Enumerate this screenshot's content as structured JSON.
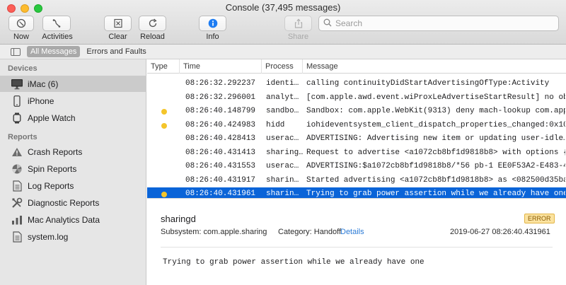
{
  "window": {
    "title": "Console (37,495 messages)"
  },
  "toolbar": {
    "now_label": "Now",
    "activities_label": "Activities",
    "clear_label": "Clear",
    "reload_label": "Reload",
    "info_label": "Info",
    "share_label": "Share",
    "search_placeholder": "Search"
  },
  "scope": {
    "all_messages": "All Messages",
    "errors_and_faults": "Errors and Faults"
  },
  "sidebar": {
    "devices_title": "Devices",
    "devices": [
      {
        "label": "iMac (6)",
        "icon": "imac-icon",
        "selected": true
      },
      {
        "label": "iPhone",
        "icon": "iphone-icon",
        "selected": false
      },
      {
        "label": "Apple Watch",
        "icon": "apple-watch-icon",
        "selected": false
      }
    ],
    "reports_title": "Reports",
    "reports": [
      {
        "label": "Crash Reports",
        "icon": "warning-icon"
      },
      {
        "label": "Spin Reports",
        "icon": "spin-icon"
      },
      {
        "label": "Log Reports",
        "icon": "document-icon"
      },
      {
        "label": "Diagnostic Reports",
        "icon": "tools-icon"
      },
      {
        "label": "Mac Analytics Data",
        "icon": "chart-icon"
      },
      {
        "label": "system.log",
        "icon": "document-icon"
      }
    ]
  },
  "table": {
    "columns": [
      "Type",
      "Time",
      "Process",
      "Message"
    ],
    "rows": [
      {
        "type": "",
        "time": "08:26:32.292237",
        "process": "identi…",
        "message": "calling continuityDidStartAdvertisingOfType:Activity",
        "selected": false
      },
      {
        "type": "",
        "time": "08:26:32.296001",
        "process": "analyt…",
        "message": "[com.apple.awd.event.wiProxLeAdvertiseStartResult] no ob…",
        "selected": false
      },
      {
        "type": "error",
        "time": "08:26:40.148799",
        "process": "sandbo…",
        "message": "Sandbox: com.apple.WebKit(9313) deny mach-lookup com.app…",
        "selected": false
      },
      {
        "type": "error",
        "time": "08:26:40.424983",
        "process": "hidd",
        "message": "iohideventsystem_client_dispatch_properties_changed:0x10…",
        "selected": false
      },
      {
        "type": "",
        "time": "08:26:40.428413",
        "process": "userac…",
        "message": "ADVERTISING: Advertising new item or updating user-idle…",
        "selected": false
      },
      {
        "type": "",
        "time": "08:26:40.431413",
        "process": "sharing…",
        "message": "Request to advertise <a1072cb8bf1d9818b8> with options {…",
        "selected": false
      },
      {
        "type": "",
        "time": "08:26:40.431553",
        "process": "userac…",
        "message": "ADVERTISING:$a1072cb8bf1d9818b8/*56 pb-1 EE0F53A2-E483-4130-…",
        "selected": false
      },
      {
        "type": "",
        "time": "08:26:40.431917",
        "process": "sharin…",
        "message": "Started advertising <a1072cb8bf1d9818b8> as <082500d35ba…",
        "selected": false
      },
      {
        "type": "error",
        "time": "08:26:40.431961",
        "process": "sharin…",
        "message": "Trying to grab power assertion while we already have one",
        "selected": true
      }
    ]
  },
  "detail": {
    "process": "sharingd",
    "badge": "ERROR",
    "subsystem": "Subsystem: com.apple.sharing",
    "category": "Category: Handoff",
    "details_link": "Details",
    "timestamp": "2019-06-27 08:26:40.431961",
    "message": "Trying to grab power assertion while we already have one"
  },
  "colors": {
    "selection": "#0a64d8",
    "error_dot": "#f4c52a",
    "link": "#2a7ad6",
    "badge_bg": "#fbe3a0"
  }
}
